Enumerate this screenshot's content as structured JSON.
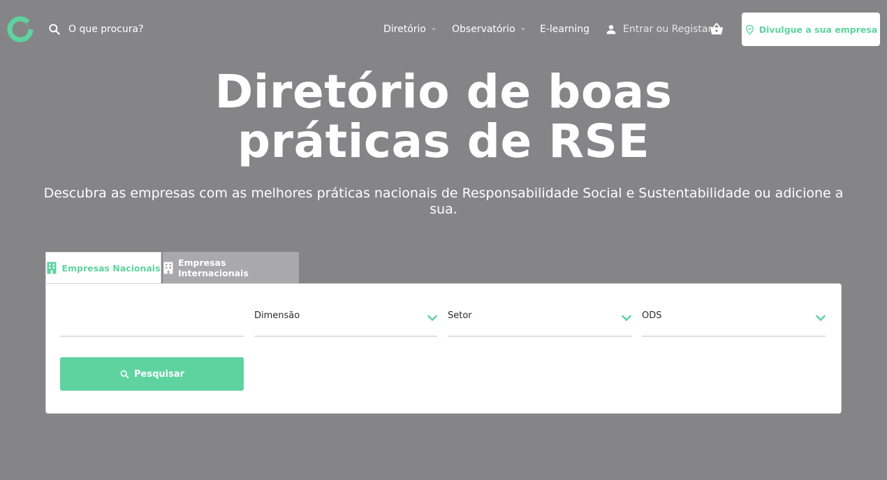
{
  "header": {
    "search_label": "O que procura?",
    "nav": {
      "diretorio": "Diretório",
      "observatorio": "Observatório",
      "elearning": "E-learning",
      "login": "Entrar ou Registar"
    },
    "cta_label": "Divulgue a sua empresa"
  },
  "hero": {
    "title_line1": "Diretório de boas",
    "title_line2": "práticas de RSE",
    "subtitle": "Descubra as empresas com as melhores práticas nacionais de Responsabilidade Social e Sustentabilidade ou adicione a sua."
  },
  "tabs": [
    {
      "label": "Empresas Nacionais",
      "active": true
    },
    {
      "label": "Empresas Internacionais",
      "active": false
    }
  ],
  "filters": {
    "text_value": "",
    "dimensao": "Dimensão",
    "setor": "Setor",
    "ods": "ODS"
  },
  "search_button": "Pesquisar",
  "icons": {
    "logo": "ring-logo",
    "search": "search-icon",
    "user": "user-icon",
    "cart": "basket-icon",
    "cta": "location-pin-icon",
    "tab": "building-icon",
    "select": "chevron-down-icon"
  },
  "colors": {
    "accent": "#5ed3a0",
    "overlay_background": "#858587",
    "inactive_tab": "#a9a9ab"
  }
}
